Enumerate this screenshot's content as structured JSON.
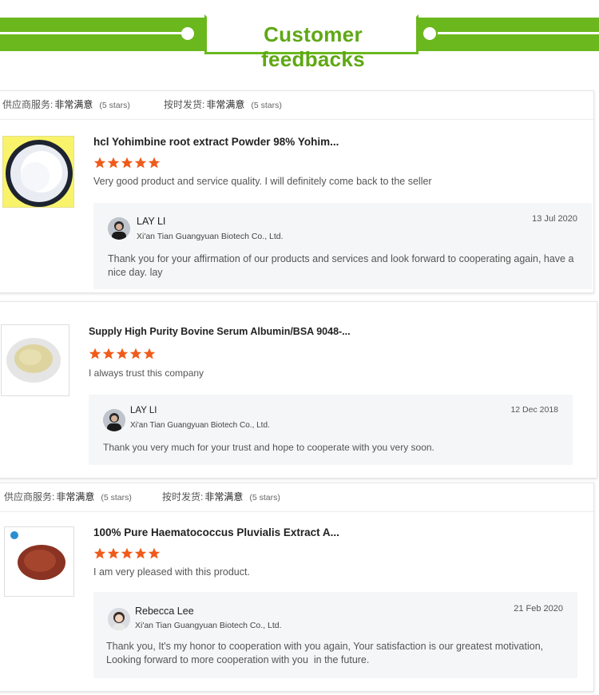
{
  "header": {
    "title": "Customer feedbacks"
  },
  "colors": {
    "brand_green": "#6bb81e",
    "star_orange": "#f05a1a"
  },
  "ratings_labels": {
    "supplier_service": "供应商服务:",
    "on_time_delivery": "按时发货:",
    "value": "非常满意",
    "stars_text": "(5 stars)"
  },
  "reviews": [
    {
      "product_title": "hcl Yohimbine root extract Powder 98% Yohim...",
      "rating": 5,
      "comment": "Very good product and service quality. I will definitely come back to the seller",
      "reply": {
        "name": "LAY LI",
        "company": "Xi'an Tian Guangyuan Biotech Co., Ltd.",
        "date": "13 Jul 2020",
        "message": "Thank you for your affirmation of our products and services and look forward to cooperating again, have a nice day. lay"
      }
    },
    {
      "product_title": "Supply High Purity Bovine Serum Albumin/BSA 9048-...",
      "rating": 5,
      "comment": "I always trust this company",
      "reply": {
        "name": "LAY LI",
        "company": "Xi'an Tian Guangyuan Biotech Co., Ltd.",
        "date": "12 Dec 2018",
        "message": "Thank you very much for your trust and hope to cooperate with you very soon."
      }
    },
    {
      "product_title": "100% Pure Haematococcus Pluvialis Extract A...",
      "rating": 5,
      "comment": "I am very pleased with this product.",
      "reply": {
        "name": "Rebecca Lee",
        "company": "Xi'an Tian Guangyuan Biotech Co., Ltd.",
        "date": "21 Feb 2020",
        "message_lines": [
          "Thank you, It's my honor to cooperation with you again, Your satisfaction is our greatest motivation,",
          "Looking forward to more cooperation with you  in the future."
        ]
      }
    }
  ]
}
